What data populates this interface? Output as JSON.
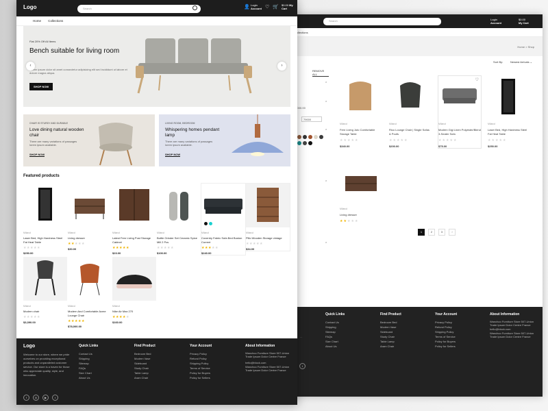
{
  "brand": {
    "logo": "Logo"
  },
  "header": {
    "search_placeholder": "Search",
    "login_label": "Login",
    "account_label": "Account",
    "cart_amount": "$0.00",
    "cart_label": "My Cart",
    "wishlist_count": "0",
    "cart_count": "0"
  },
  "nav": {
    "home": "Home",
    "collections": "Collections"
  },
  "hero": {
    "tag": "Flat 20% Off All Items",
    "title": "Bench suitable for living room",
    "subtitle": "Lorem ipsum dolor sit amet consectetur adipisicing elit sed incididunt ut labore et dolore magna aliqua.",
    "button": "SHOP NOW"
  },
  "promos": [
    {
      "tag": "CHAIR IS STURDY AND DURABLE",
      "title": "Love dining natural wooden chair",
      "desc": "There are many variations of passages lorem ipsum available.",
      "link": "SHOP NOW"
    },
    {
      "tag": "LIVING ROOM, BEDROOM",
      "title": "Whispering homes pendant lamp",
      "desc": "There are many variations of passages lorem ipsum available.",
      "link": "SHOP NOW"
    }
  ],
  "featured": {
    "heading": "Featured products",
    "products": [
      {
        "cat": "Milanol",
        "name": "Laser Bed, High Hardness Steel Fat Heat Table",
        "stars": "★★★★★",
        "price": "$250.00",
        "rated": 0
      },
      {
        "cat": "Milanol",
        "name": "Living dresser",
        "stars": "★★★★★",
        "price": "$30.00",
        "rated": 2
      },
      {
        "cat": "Milanol",
        "name": "Latest Fern Living Post Storage Cabinet",
        "stars": "★★★★★",
        "price": "$23.00",
        "rated": 5
      },
      {
        "cat": "Milanol",
        "name": "Bottle Grinder Set Ceramic Spice Mill 2 Pcs",
        "stars": "★★★★★",
        "price": "$100.00",
        "rated": 0
      },
      {
        "cat": "Milanol",
        "name": "Coventry Fabric Sofa Bed Boston Current",
        "stars": "★★★★★",
        "price": "$240.00",
        "rated": 3
      },
      {
        "cat": "Milanol",
        "name": "Pillo Wooden Storage vintage",
        "stars": "★★★★★",
        "price": "$34.00",
        "rated": 0
      },
      {
        "cat": "Milanol",
        "name": "Modern chair",
        "stars": "★★★★★",
        "price": "$3,390.00",
        "rated": 0
      },
      {
        "cat": "Milanol",
        "name": "Modern And Comfortable Acme Lounge Chair",
        "stars": "★★★★★",
        "price": "$78,000.00",
        "rated": 5
      },
      {
        "cat": "Milanol",
        "name": "Nike Air Max 270",
        "stars": "★★★★★",
        "price": "$160.00",
        "rated": 4
      }
    ]
  },
  "footer": {
    "about_text": "Welcome to our store, where we pride ourselves on providing exceptional products and unparalleled customer service. Our store is a haven for those who appreciate quality, style, and innovation.",
    "quick_links": {
      "title": "Quick Links",
      "items": [
        "Contact Us",
        "Shipping",
        "Sitemap",
        "FAQs",
        "Size Chart",
        "About Us"
      ]
    },
    "find_product": {
      "title": "Find Product",
      "items": [
        "Bedroom Bed",
        "Modern Vase",
        "Sideboard",
        "Study Chair",
        "Table Lamp",
        "Aram Chair"
      ]
    },
    "your_account": {
      "title": "Your Account",
      "items": [
        "Privacy Policy",
        "Refund Policy",
        "Shipping Policy",
        "Terms of Service",
        "Policy for Buyers",
        "Policy for Sellers"
      ]
    },
    "about_info": {
      "title": "About Information",
      "address": "Wanchoo Furniture Store 507-Union Trade Ipsum Dolor Centre France",
      "email": "hello@block.com",
      "address2": "Wanchoo Furniture Store 507-Union Trade Ipsum Dolor Centre France"
    }
  },
  "back_page": {
    "bread": "Home > Shop",
    "remove_all": "REMOVE ALL",
    "sort_label": "Sort By:",
    "sort_value": "Newest Arrivals",
    "price_from": "$0",
    "price_to": "$9,000.00",
    "price_box": "79000",
    "swatch_colors": [
      "#8b5a3c",
      "#333333",
      "#a0522d",
      "#ddd6c8",
      "#3b3b3b",
      "#1a8a8a",
      "#444444",
      "#111111"
    ],
    "products": [
      {
        "cat": "Milanol",
        "name": "Fern Living Juto Comfortable Storage Table",
        "price": "$340.00"
      },
      {
        "cat": "Milanol",
        "name": "Rico Lounge Chair | Single Sofas & Poufs",
        "price": "$200.00"
      },
      {
        "cat": "Milanol",
        "name": "Modern Gigi Linen Polyester/Blend 3-Seater Sofa",
        "price": "$75.00"
      },
      {
        "cat": "Milanol",
        "name": "Laser Bed, High Hardness Steel Fat Heat Table",
        "price": "$250.00"
      },
      {
        "cat": "Milanol",
        "name": "Living dresser",
        "price": ""
      }
    ],
    "pages": [
      "1",
      "2",
      "3",
      "›"
    ],
    "stars": "★★★★★",
    "footer_heads": [
      "Quick Links",
      "Find Product",
      "Your Account",
      "About Information"
    ]
  }
}
